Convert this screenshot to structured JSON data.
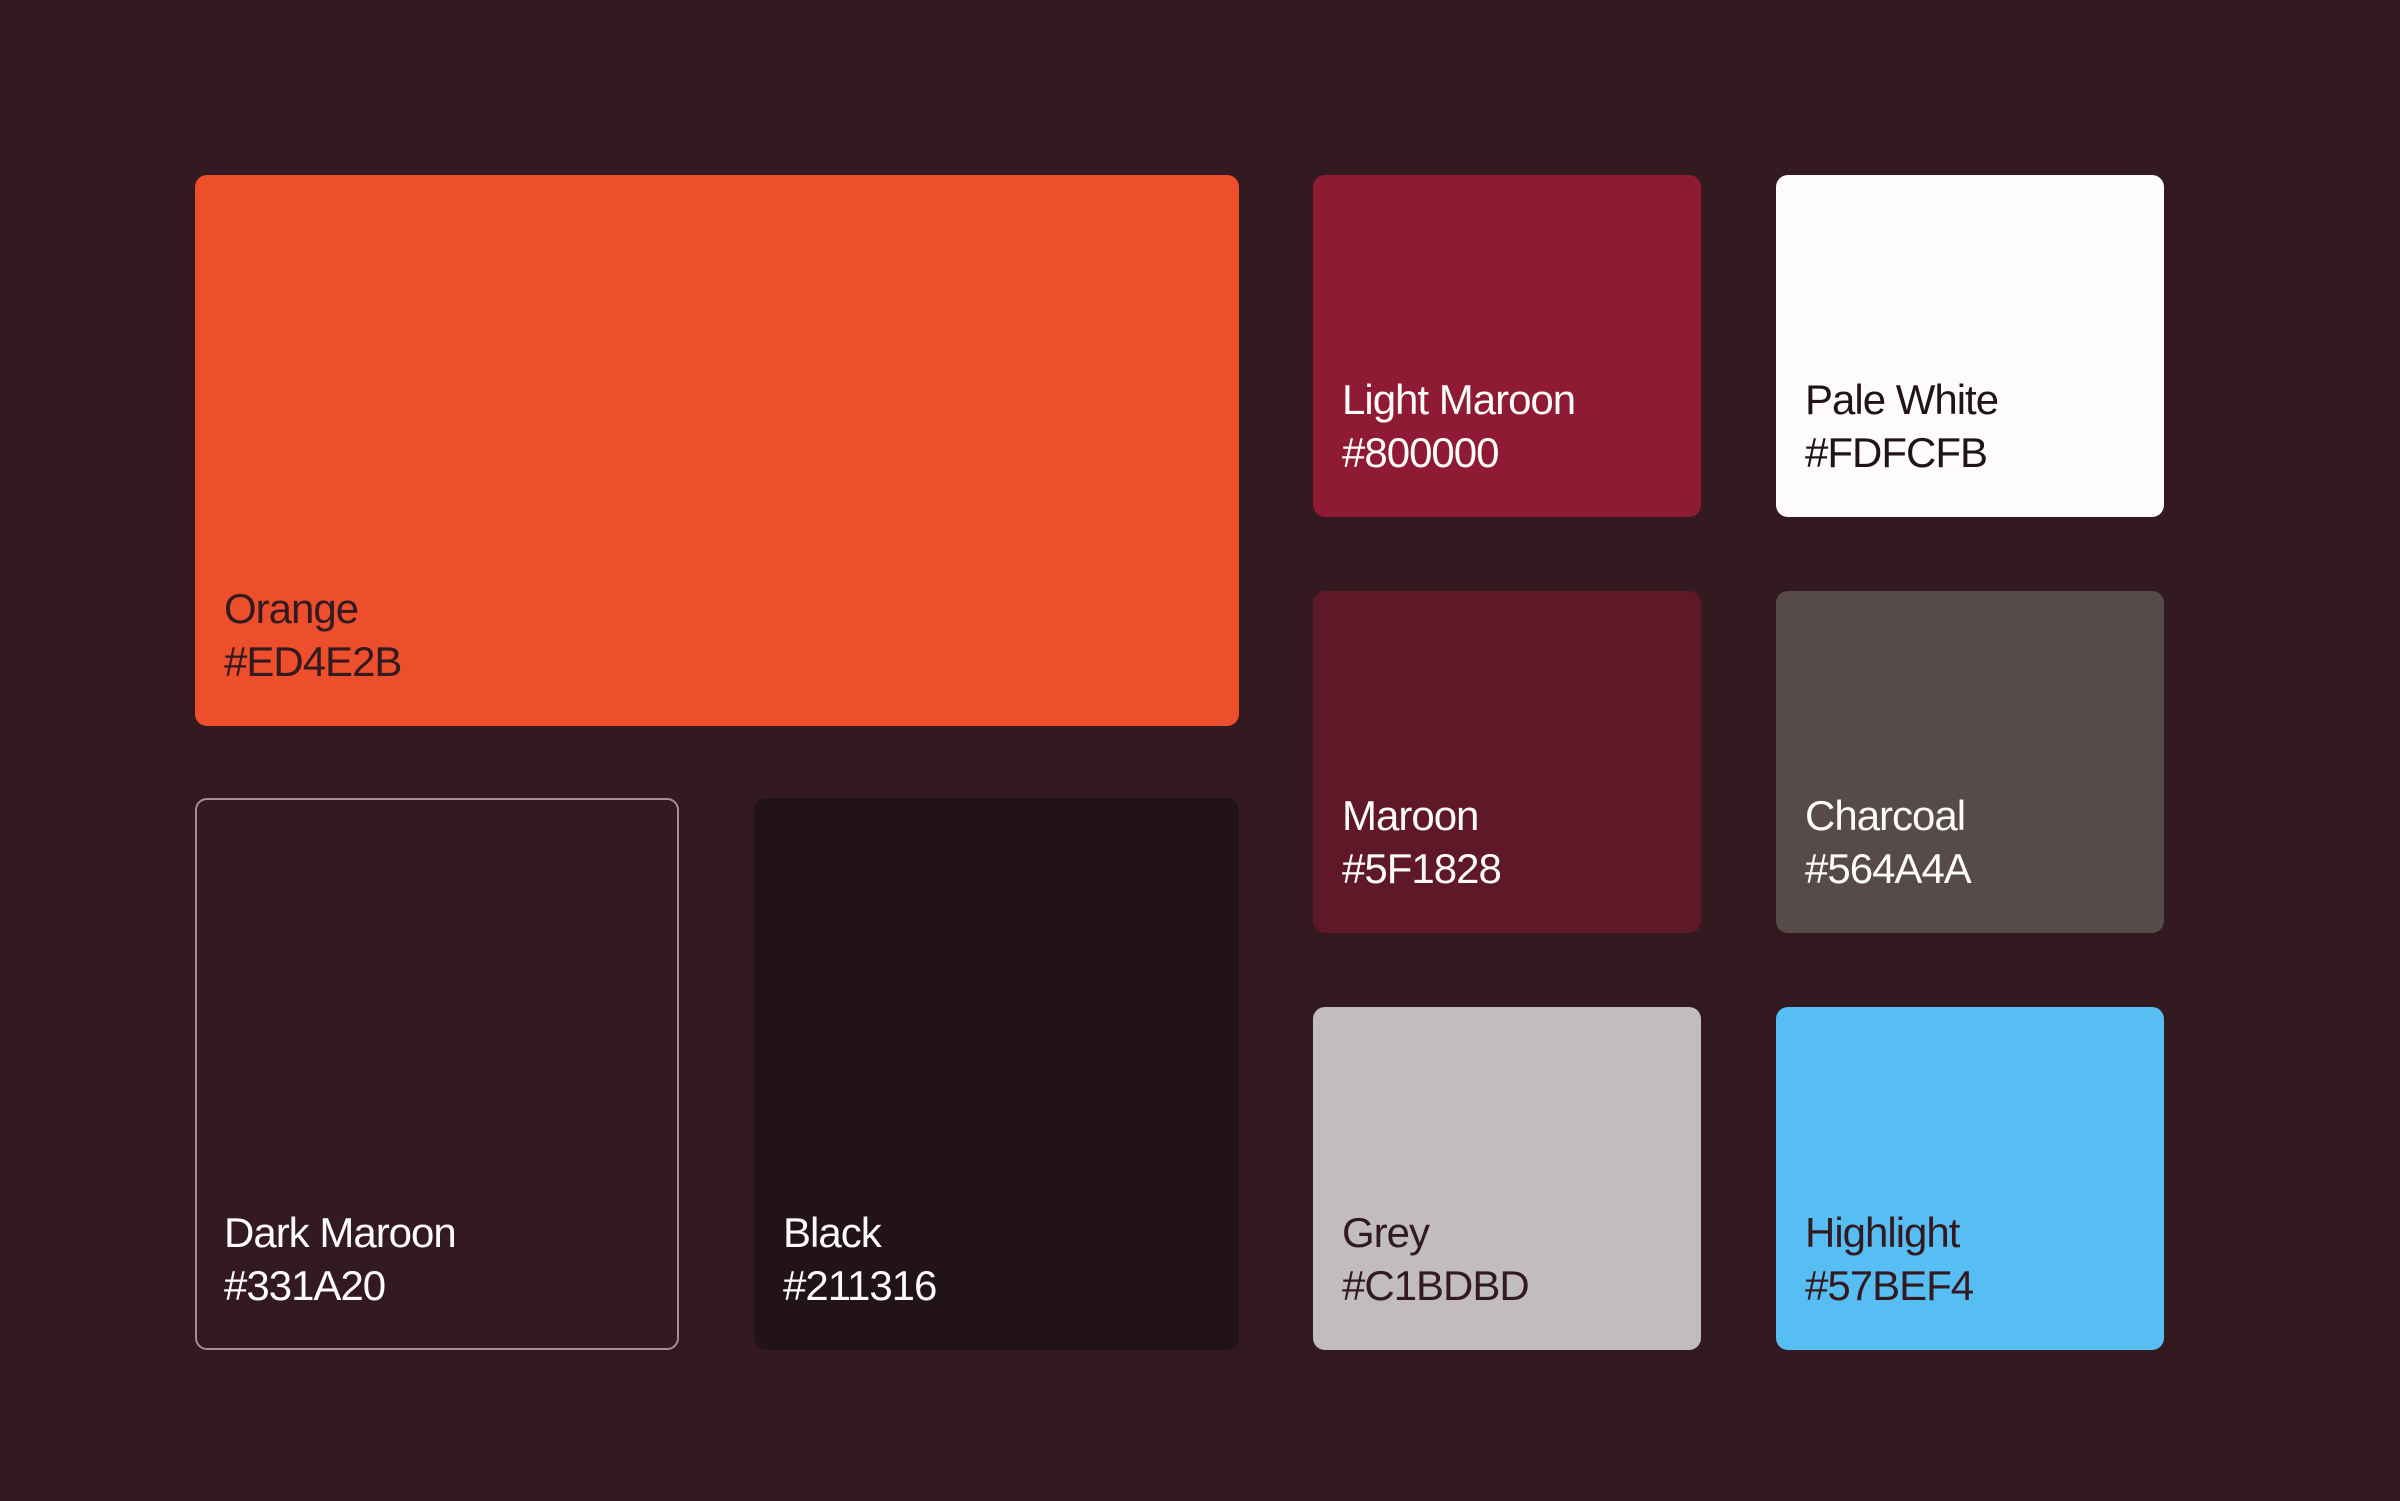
{
  "background": "#331A20",
  "swatches": [
    {
      "key": "orange",
      "name": "Orange",
      "hex": "#ED4E2B",
      "fill": "#ED4E2B",
      "text_color": "#331A20"
    },
    {
      "key": "dark_maroon",
      "name": "Dark Maroon",
      "hex": "#331A20",
      "fill": "#331A20",
      "text_color": "#FDFCFB"
    },
    {
      "key": "black",
      "name": "Black",
      "hex": "#211316",
      "fill": "#211316",
      "text_color": "#FDFCFB"
    },
    {
      "key": "light_maroon",
      "name": "Light Maroon",
      "hex": "#800000",
      "fill": "#8E1A33",
      "text_color": "#FDFCFB"
    },
    {
      "key": "pale_white",
      "name": "Pale White",
      "hex": "#FDFCFB",
      "fill": "#FDFCFB",
      "text_color": "#211316"
    },
    {
      "key": "maroon",
      "name": "Maroon",
      "hex": "#5F1828",
      "fill": "#5F1828",
      "text_color": "#FDFCFB"
    },
    {
      "key": "charcoal",
      "name": "Charcoal",
      "hex": "#564A4A",
      "fill": "#564A4A",
      "text_color": "#FDFCFB"
    },
    {
      "key": "grey",
      "name": "Grey",
      "hex": "#C1BDBD",
      "fill": "#C1BDBD",
      "text_color": "#331A20"
    },
    {
      "key": "highlight",
      "name": "Highlight",
      "hex": "#57BEF4",
      "fill": "#57BEF4",
      "text_color": "#331A20"
    }
  ]
}
